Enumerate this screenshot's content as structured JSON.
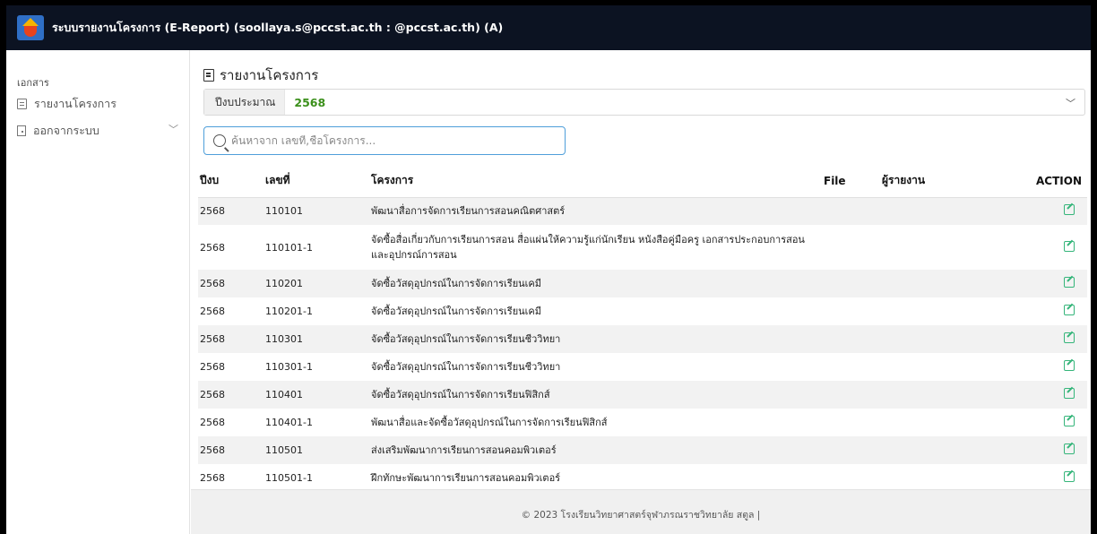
{
  "app": {
    "title": "ระบบรายงานโครงการ (E-Report) (soollaya.s@pccst.ac.th : @pccst.ac.th) (A)",
    "logo": "school-logo"
  },
  "sidebar": {
    "section": "เอกสาร",
    "items": [
      {
        "label": "รายงานโครงการ",
        "icon": "document-icon"
      },
      {
        "label": "ออกจากระบบ",
        "icon": "logout-icon"
      }
    ]
  },
  "main": {
    "heading": "รายงานโครงการ",
    "budget_label": "ปีงบประมาณ",
    "budget_value": "2568",
    "search_placeholder": "ค้นหาจาก เลขที่,ชื่อโครงการ...",
    "columns": [
      "ปีงบ",
      "เลขที่",
      "โครงการ",
      "File",
      "ผู้รายงาน",
      "ACTION"
    ],
    "rows": [
      {
        "year": "2568",
        "no": "110101",
        "name": "พัฒนาสื่อการจัดการเรียนการสอนคณิตศาสตร์",
        "file": "",
        "reporter": ""
      },
      {
        "year": "2568",
        "no": "110101-1",
        "name": "จัดซื้อสื่อเกี่ยวกับการเรียนการสอน สื่อแผ่นให้ความรู้แก่นักเรียน หนังสือคู่มือครู เอกสารประกอบการสอน และอุปกรณ์การสอน",
        "file": "",
        "reporter": ""
      },
      {
        "year": "2568",
        "no": "110201",
        "name": "จัดซื้อวัสดุอุปกรณ์ในการจัดการเรียนเคมี",
        "file": "",
        "reporter": ""
      },
      {
        "year": "2568",
        "no": "110201-1",
        "name": "จัดซื้อวัสดุอุปกรณ์ในการจัดการเรียนเคมี",
        "file": "",
        "reporter": ""
      },
      {
        "year": "2568",
        "no": "110301",
        "name": "จัดซื้อวัสดุอุปกรณ์ในการจัดการเรียนชีววิทยา",
        "file": "",
        "reporter": ""
      },
      {
        "year": "2568",
        "no": "110301-1",
        "name": "จัดซื้อวัสดุอุปกรณ์ในการจัดการเรียนชีววิทยา",
        "file": "",
        "reporter": ""
      },
      {
        "year": "2568",
        "no": "110401",
        "name": "จัดซื้อวัสดุอุปกรณ์ในการจัดการเรียนฟิสิกส์",
        "file": "",
        "reporter": ""
      },
      {
        "year": "2568",
        "no": "110401-1",
        "name": "พัฒนาสื่อและจัดซื้อวัสดุอุปกรณ์ในการจัดการเรียนฟิสิกส์",
        "file": "",
        "reporter": ""
      },
      {
        "year": "2568",
        "no": "110501",
        "name": "ส่งเสริมพัฒนาการเรียนการสอนคอมพิวเตอร์",
        "file": "",
        "reporter": ""
      },
      {
        "year": "2568",
        "no": "110501-1",
        "name": "ฝึกทักษะพัฒนาการเรียนการสอนคอมพิวเตอร์",
        "file": "",
        "reporter": ""
      }
    ]
  },
  "footer": {
    "text": "© 2023 โรงเรียนวิทยาศาสตร์จุฬาภรณราชวิทยาลัย สตูล |"
  },
  "colors": {
    "topbar": "#0c1322",
    "budget_value": "#3a8f1a",
    "edit_icon": "#35b57a",
    "search_border": "#4f9fda"
  }
}
